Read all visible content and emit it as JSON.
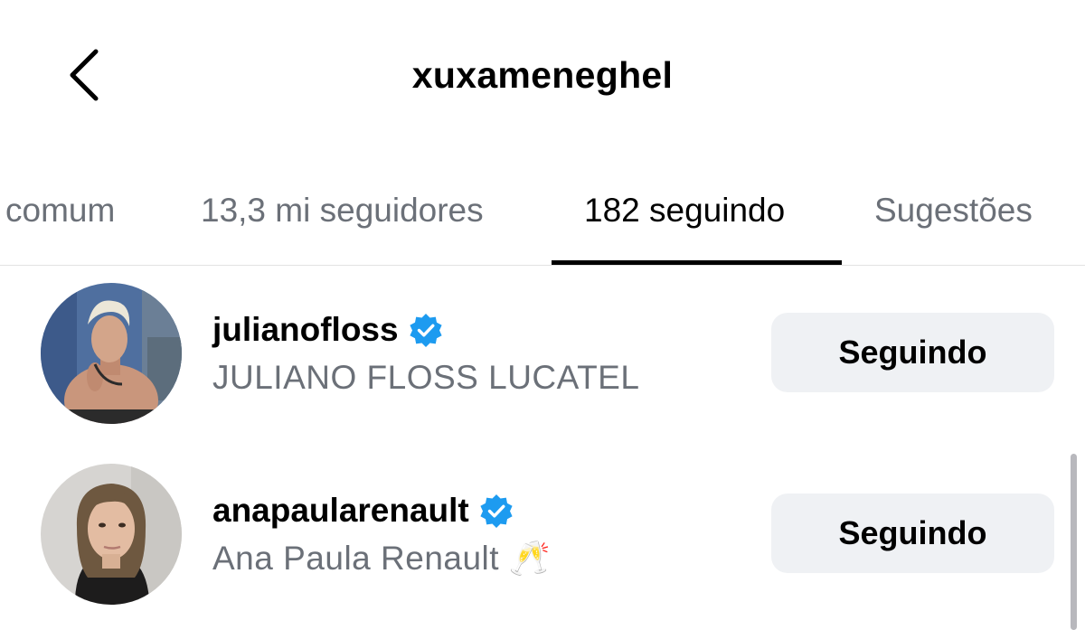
{
  "header": {
    "title": "xuxameneghel",
    "back_icon": "chevron-left-icon"
  },
  "tabs": [
    {
      "label": "comum",
      "active": false
    },
    {
      "label": "13,3 mi seguidores",
      "active": false
    },
    {
      "label": "182 seguindo",
      "active": true
    },
    {
      "label": "Sugestões",
      "active": false
    }
  ],
  "following": [
    {
      "username": "julianofloss",
      "full_name": "JULIANO FLOSS LUCATEL",
      "verified": true,
      "button_label": "Seguindo"
    },
    {
      "username": "anapaularenault",
      "full_name": "Ana Paula Renault 🥂",
      "verified": true,
      "button_label": "Seguindo"
    }
  ],
  "colors": {
    "verified_badge": "#1d9bf0",
    "button_bg": "#eff1f4",
    "secondary_text": "#6b7078",
    "active_tab": "#000000"
  }
}
